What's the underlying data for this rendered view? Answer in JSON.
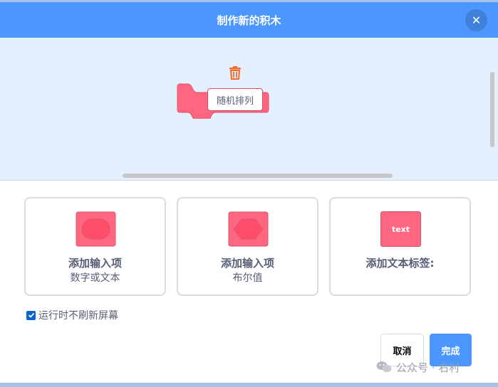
{
  "dialog": {
    "title": "制作新的积木",
    "close_glyph": "✕"
  },
  "workspace": {
    "block_label": "随机排列",
    "block_color": "#ff6680",
    "trash_color": "#f26b29"
  },
  "cards": [
    {
      "title": "添加输入项",
      "subtitle": "数字或文本",
      "icon": "number-text-input-icon"
    },
    {
      "title": "添加输入项",
      "subtitle": "布尔值",
      "icon": "boolean-input-icon"
    },
    {
      "title": "添加文本标签:",
      "subtitle": "",
      "icon": "text-label-icon",
      "icon_text": "text"
    }
  ],
  "options": {
    "run_without_refresh": {
      "label": "运行时不刷新屏幕",
      "checked": true
    }
  },
  "buttons": {
    "cancel": "取消",
    "ok": "完成"
  },
  "watermark": {
    "text": "公众号 · 右村"
  },
  "colors": {
    "header": "#4c97ff",
    "workspace_bg": "#e5f0ff",
    "accent": "#ff6680"
  }
}
